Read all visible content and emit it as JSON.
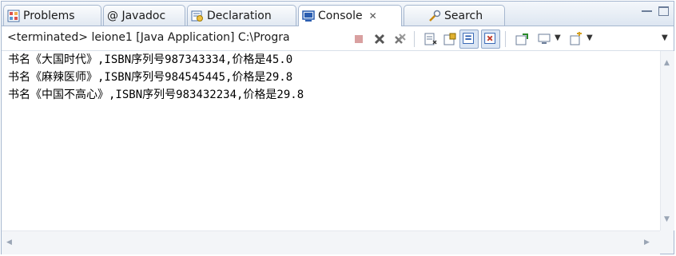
{
  "tabs": [
    {
      "label": "Problems",
      "icon": "problems-icon"
    },
    {
      "label": "@ Javadoc",
      "icon": ""
    },
    {
      "label": "Declaration",
      "icon": "declaration-icon"
    },
    {
      "label": "Console",
      "icon": "console-icon",
      "active": true,
      "close": "✕"
    },
    {
      "label": "Search",
      "icon": "search-icon"
    }
  ],
  "toolbar": {
    "status": "<terminated> leione1 [Java Application] C:\\Progra"
  },
  "console": {
    "lines": [
      "书名《大国时代》,ISBN序列号987343334,价格是45.0",
      "书名《麻辣医师》,ISBN序列号984545445,价格是29.8",
      "书名《中国不高心》,ISBN序列号983432234,价格是29.8"
    ]
  },
  "colors": {
    "accent": "#2a5db0",
    "border": "#a6b7cf",
    "terminate_red": "#c0392b"
  }
}
